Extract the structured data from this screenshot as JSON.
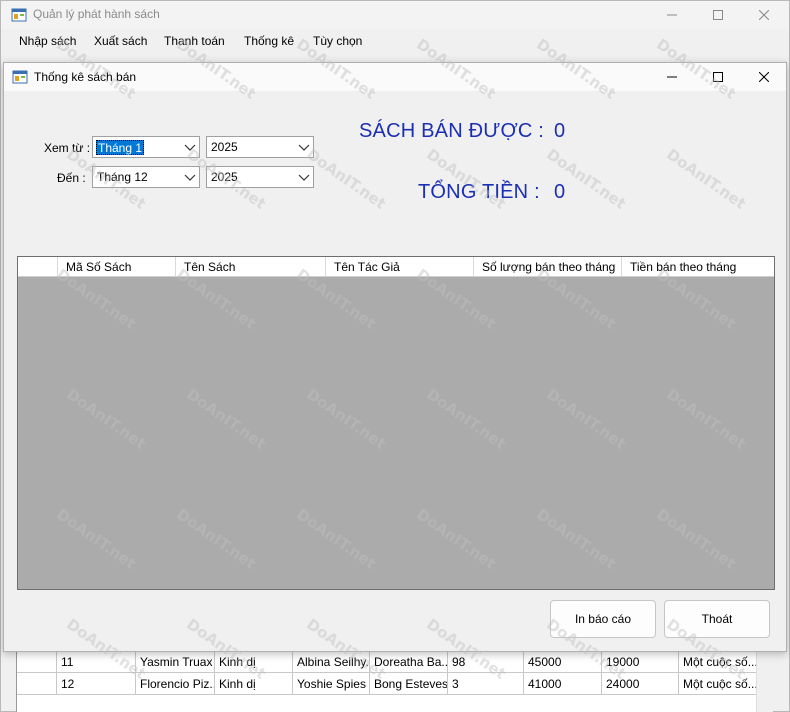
{
  "parent": {
    "title": "Quản lý phát hành sách",
    "menu": [
      "Nhập sách",
      "Xuất sách",
      "Thanh toán",
      "Thống kê",
      "Tùy chọn"
    ],
    "grid_rows": [
      [
        "11",
        "Yasmin Truax",
        "Kinh dị",
        "Albina Seilhy...",
        "Doreatha Ba...",
        "98",
        "45000",
        "19000",
        "Một cuộc số..."
      ],
      [
        "12",
        "Florencio Piz...",
        "Kinh dị",
        "Yoshie Spies",
        "Bong Esteves",
        "3",
        "41000",
        "24000",
        "Một cuộc số..."
      ]
    ]
  },
  "child": {
    "title": "Thống kê sách bán",
    "from_label": "Xem từ :",
    "to_label": "Đến :",
    "from_month": "Tháng 1",
    "from_year": "2025",
    "to_month": "Tháng 12",
    "to_year": "2025",
    "sold_label": "SÁCH BÁN ĐƯỢC :",
    "sold_value": "0",
    "total_label": "TỔNG TIỀN :",
    "total_value": "0",
    "columns": [
      "Mã Số Sách",
      "Tên Sách",
      "Tên Tác Giả",
      "Số lượng bán theo tháng",
      "Tiền bán theo tháng"
    ],
    "print_button": "In báo cáo",
    "exit_button": "Thoát"
  },
  "watermark": "DoAnIT.net",
  "colors": {
    "accent_text": "#1a2fb4",
    "grid_bg": "#ababab",
    "selection": "#0078d7"
  }
}
